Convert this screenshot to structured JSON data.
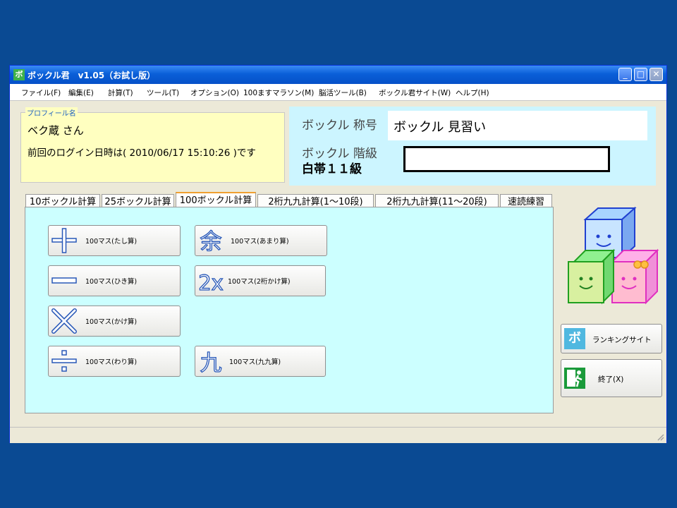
{
  "window": {
    "title": "ボックル君　v1.05（お試し版）",
    "app_icon_glyph": "ボ",
    "minimize_glyph": "_",
    "maximize_glyph": "□",
    "close_glyph": "✕"
  },
  "menu": [
    "ファイル(F)",
    "編集(E)",
    "計算(T)",
    "ツール(T)",
    "オプション(O)",
    "100ますマラソン(M)",
    "脳活ツール(B)",
    "ボックル君サイト(W)",
    "ヘルプ(H)"
  ],
  "profile": {
    "legend": "プロフィール名",
    "name": "ベク蔵 さん",
    "last_login": "前回のログイン日時は( 2010/06/17 15:10:26 )です"
  },
  "rank": {
    "title_label": "ボックル 称号",
    "title_value": "ボックル 見習い",
    "level_label": "ボックル 階級",
    "level_value": "白帯１１級",
    "level_progress": 0
  },
  "tabs": [
    {
      "label": "10ボックル計算",
      "active": false
    },
    {
      "label": "25ボックル計算",
      "active": false
    },
    {
      "label": "100ボックル計算",
      "active": true
    },
    {
      "label": "2桁九九計算(1〜10段)",
      "active": false
    },
    {
      "label": "2桁九九計算(11〜20段)",
      "active": false
    },
    {
      "label": "速読練習",
      "active": false
    }
  ],
  "calc_buttons": {
    "add": {
      "label": "100マス(たし算)",
      "icon": "plus-icon"
    },
    "sub": {
      "label": "100マス(ひき算)",
      "icon": "minus-icon"
    },
    "mul": {
      "label": "100マス(かけ算)",
      "icon": "multiply-icon"
    },
    "div": {
      "label": "100マス(わり算)",
      "icon": "divide-icon"
    },
    "rem": {
      "label": "100マス(あまり算)",
      "icon": "remainder-icon",
      "glyph": "余"
    },
    "mul2": {
      "label": "100マス(2桁かけ算)",
      "icon": "two-x-icon",
      "glyph": "2x"
    },
    "kuku": {
      "label": "100マス(九九算)",
      "icon": "kuku-icon",
      "glyph": "九"
    }
  },
  "side": {
    "ranking_label": "ランキングサイト",
    "ranking_glyph": "ボ",
    "exit_label": "終了(X)"
  },
  "colors": {
    "desktop": "#0a4a93",
    "profile_bg": "#ffffc0",
    "rank_bg": "#ccf5ff",
    "panel_bg": "#ccffff",
    "icon_blue": "#2858b8"
  }
}
